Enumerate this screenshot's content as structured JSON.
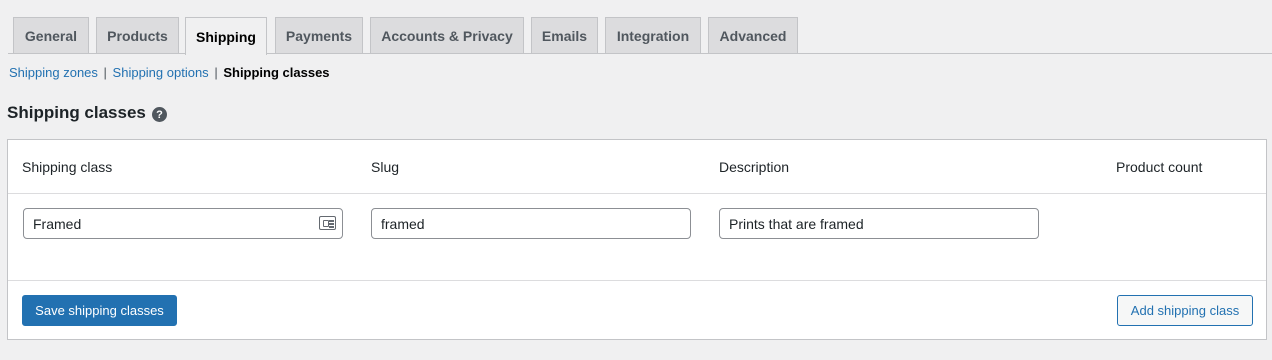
{
  "tabs": [
    {
      "label": "General",
      "active": false
    },
    {
      "label": "Products",
      "active": false
    },
    {
      "label": "Shipping",
      "active": true
    },
    {
      "label": "Payments",
      "active": false
    },
    {
      "label": "Accounts & Privacy",
      "active": false
    },
    {
      "label": "Emails",
      "active": false
    },
    {
      "label": "Integration",
      "active": false
    },
    {
      "label": "Advanced",
      "active": false
    }
  ],
  "subnav": {
    "zones": "Shipping zones",
    "separator": "|",
    "options": "Shipping options",
    "classes": "Shipping classes"
  },
  "page": {
    "title": "Shipping classes",
    "help_icon": "question-mark-icon",
    "help_glyph": "?"
  },
  "table": {
    "columns": [
      "Shipping class",
      "Slug",
      "Description",
      "Product count"
    ],
    "row": {
      "shipping_class": "Framed",
      "slug": "framed",
      "description": "Prints that are framed",
      "product_count": ""
    }
  },
  "footer": {
    "save_label": "Save shipping classes",
    "add_label": "Add shipping class"
  },
  "colors": {
    "accent": "#2271b1",
    "background": "#f0f0f1",
    "tab_inactive": "#dcdcde"
  }
}
